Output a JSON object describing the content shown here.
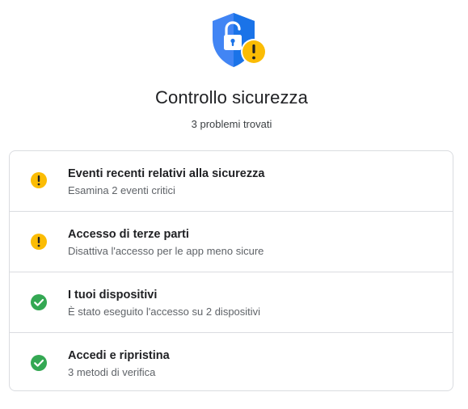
{
  "header": {
    "hero_icon": "shield-unlocked-warning-icon",
    "title": "Controllo sicurezza",
    "subtitle": "3 problemi trovati"
  },
  "colors": {
    "shield_blue": "#4285f4",
    "shield_blue_dark": "#1a73e8",
    "warning_yellow": "#fbbc04",
    "success_green": "#34a853",
    "border": "#dadce0"
  },
  "items": [
    {
      "status": "warning",
      "icon": "warning-icon",
      "title": "Eventi recenti relativi alla sicurezza",
      "description": "Esamina 2 eventi critici"
    },
    {
      "status": "warning",
      "icon": "warning-icon",
      "title": "Accesso di terze parti",
      "description": "Disattiva l'accesso per le app meno sicure"
    },
    {
      "status": "ok",
      "icon": "check-circle-icon",
      "title": "I tuoi dispositivi",
      "description": "È stato eseguito l'accesso su 2 dispositivi"
    },
    {
      "status": "ok",
      "icon": "check-circle-icon",
      "title": "Accedi e ripristina",
      "description": "3 metodi di verifica"
    }
  ]
}
